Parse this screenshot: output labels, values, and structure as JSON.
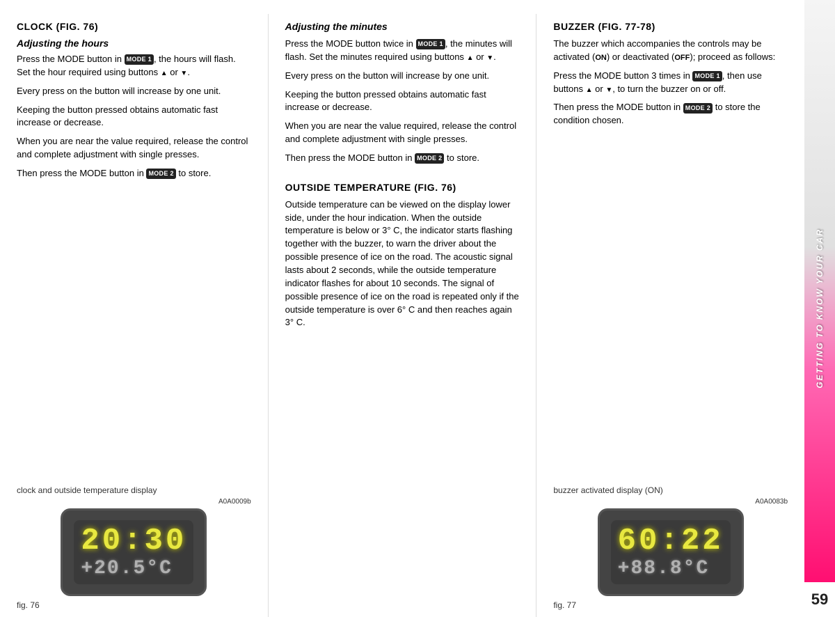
{
  "columns": [
    {
      "id": "clock",
      "heading": "CLOCK (fig. 76)",
      "subheading": "Adjusting the hours",
      "paragraphs": [
        "Press the MODE button in MODE1, the hours will flash. Set the hour required using buttons ▲ or ▼.",
        "Every press on the button will increase by one unit.",
        "Keeping the button pressed obtains automatic fast increase or decrease.",
        "When you are near the value required, release the control and complete adjustment with single presses.",
        "Then press the MODE button in MODE2 to store."
      ],
      "fig_caption_pre": "clock and outside temperature display",
      "fig_ref": "A0A0009b",
      "fig_display_time": "20:30",
      "fig_display_temp": "+20.5°C",
      "fig_label": "fig. 76"
    },
    {
      "id": "minutes",
      "heading_italic": "Adjusting the minutes",
      "paragraphs_min": [
        "Press the MODE button twice in MODE1, the minutes will flash. Set the minutes required using buttons ▲ or ▼.",
        "Every press on the button will increase by one unit.",
        "Keeping the button pressed obtains automatic fast increase or decrease.",
        "When you are near the value required, release the control and complete adjustment with single presses.",
        "Then press the MODE button in MODE2 to store."
      ],
      "outside_heading": "OUTSIDE TEMPERATURE (fig. 76)",
      "outside_paragraphs": [
        "Outside temperature can be viewed on the display lower side, under the hour indication. When the outside temperature is below or 3° C, the indicator starts flashing together with the buzzer, to warn the driver about the possible presence of ice on the road. The acoustic signal lasts about 2 seconds, while the outside temperature indicator flashes for about 10 seconds. The signal of possible presence of ice on the road is repeated only if the outside temperature is over 6° C and then reaches again 3° C."
      ]
    },
    {
      "id": "buzzer",
      "heading": "BUZZER (fig. 77-78)",
      "paragraphs": [
        "The buzzer which accompanies the controls may be activated (ON) or deactivated (OFF); proceed as follows:",
        "Press the MODE button 3 times in MODE1, then use buttons ▲ or ▼, to turn the buzzer on or off.",
        "Then press the MODE button in MODE2 to store the condition chosen."
      ],
      "fig_caption_pre": "buzzer activated display (ON)",
      "fig_ref": "A0A0083b",
      "fig_display_time": "60:22",
      "fig_display_temp": "+88.8°C",
      "fig_label": "fig. 77"
    }
  ],
  "sidebar": {
    "text": "GETTING TO KNOW YOUR CAR",
    "page_number": "59"
  },
  "badges": {
    "mode1": "MODE 1",
    "mode2": "MODE 2"
  }
}
